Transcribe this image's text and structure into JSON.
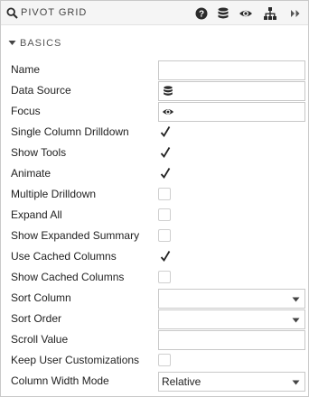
{
  "panel": {
    "title": "PIVOT GRID"
  },
  "header_icons": [
    "help-icon",
    "database-icon",
    "eye-icon",
    "hierarchy-icon",
    "double-chevron-right-icon"
  ],
  "section": {
    "label": "BASICS"
  },
  "fields": {
    "name": {
      "label": "Name",
      "value": ""
    },
    "data_source": {
      "label": "Data Source"
    },
    "focus": {
      "label": "Focus"
    },
    "single_column_drilldown": {
      "label": "Single Column Drilldown",
      "checked": true
    },
    "show_tools": {
      "label": "Show Tools",
      "checked": true
    },
    "animate": {
      "label": "Animate",
      "checked": true
    },
    "multiple_drilldown": {
      "label": "Multiple Drilldown",
      "checked": false
    },
    "expand_all": {
      "label": "Expand All",
      "checked": false
    },
    "show_expanded_summary": {
      "label": "Show Expanded Summary",
      "checked": false
    },
    "use_cached_columns": {
      "label": "Use Cached Columns",
      "checked": true
    },
    "show_cached_columns": {
      "label": "Show Cached Columns",
      "checked": false
    },
    "sort_column": {
      "label": "Sort Column",
      "value": ""
    },
    "sort_order": {
      "label": "Sort Order",
      "value": ""
    },
    "scroll_value": {
      "label": "Scroll Value",
      "value": ""
    },
    "keep_user_customizations": {
      "label": "Keep User Customizations",
      "checked": false
    },
    "column_width_mode": {
      "label": "Column Width Mode",
      "value": "Relative"
    }
  },
  "colors": {
    "checkmark": "#222222",
    "icon": "#2b2b2b",
    "border": "#c8c8c8"
  }
}
